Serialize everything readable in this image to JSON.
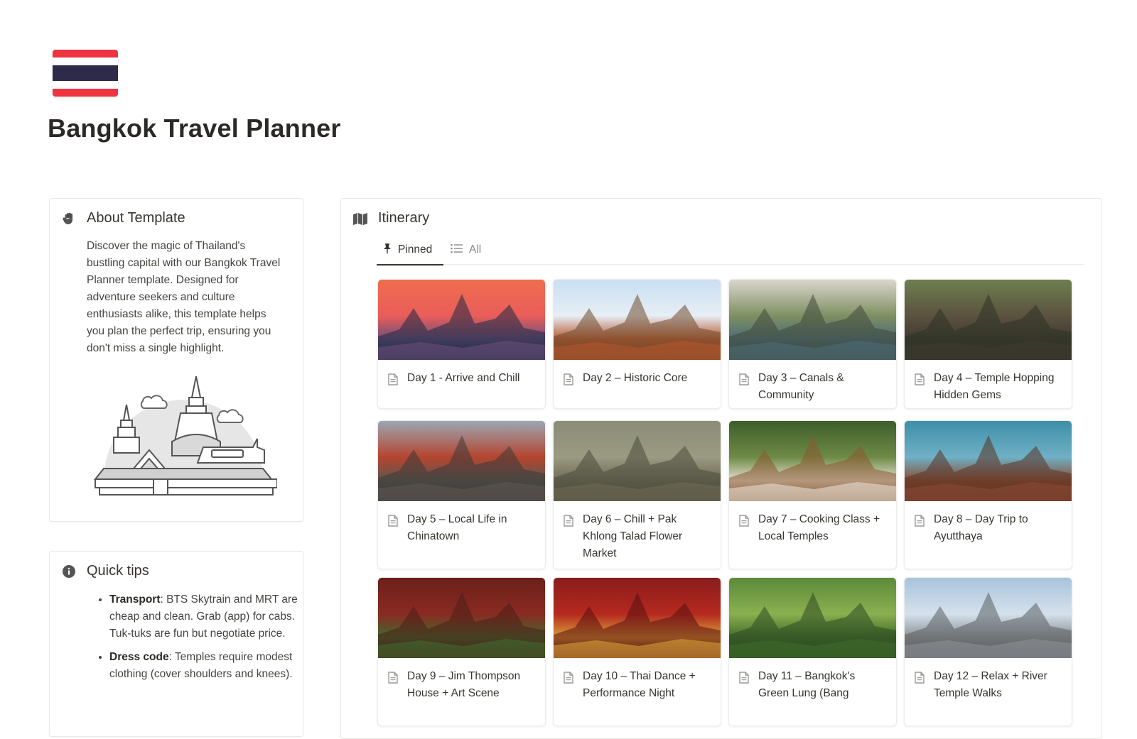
{
  "page": {
    "title": "Bangkok Travel Planner",
    "flag_icon": "thailand-flag-icon"
  },
  "about": {
    "icon": "hand-icon",
    "title": "About Template",
    "text": "Discover the magic of Thailand's bustling capital with our Bangkok Travel Planner template. Designed for adventure seekers and culture enthusiasts alike, this template helps you plan the perfect trip, ensuring you don't miss a single highlight.",
    "illustration_icon": "temple-illustration-icon"
  },
  "tips": {
    "icon": "info-icon",
    "title": "Quick tips",
    "items": [
      {
        "label": "Transport",
        "text": ": BTS Skytrain and MRT are cheap and clean. Grab (app) for cabs. Tuk-tuks are fun but negotiate price."
      },
      {
        "label": "Dress code",
        "text": ": Temples require modest clothing (cover shoulders and knees)."
      }
    ]
  },
  "itinerary": {
    "icon": "map-icon",
    "title": "Itinerary",
    "tabs": [
      {
        "label": "Pinned",
        "icon": "pin-icon",
        "active": true
      },
      {
        "label": "All",
        "icon": "list-icon",
        "active": false
      }
    ],
    "cards": [
      {
        "title": "Day 1 - Arrive and Chill",
        "image": "wat-arun-sunset",
        "colors": [
          "#f06d4f",
          "#e95d5a",
          "#6b4f7a",
          "#1f2a44"
        ]
      },
      {
        "title": "Day 2 – Historic Core",
        "image": "grand-palace",
        "colors": [
          "#c9dff2",
          "#e7eef5",
          "#b4552c",
          "#6f4a2e"
        ]
      },
      {
        "title": "Day 3 – Canals & Community",
        "image": "floating-canal",
        "colors": [
          "#d9d7cc",
          "#7f8f62",
          "#4b6a78",
          "#3f4a3a"
        ]
      },
      {
        "title": "Day 4 – Temple Hopping Hidden Gems",
        "image": "ruins-temple",
        "colors": [
          "#6d7f4e",
          "#5b5240",
          "#3f3a30",
          "#2e3326"
        ]
      },
      {
        "title": "Day 5 – Local Life in Chinatown",
        "image": "chinatown-street",
        "colors": [
          "#9aa7b4",
          "#b5452f",
          "#5d5650",
          "#3b3a38"
        ]
      },
      {
        "title": "Day 6 – Chill + Pak Khlong Talad Flower Market",
        "image": "sailing-ships-painting",
        "colors": [
          "#8a8d78",
          "#9b9a82",
          "#6e6a55",
          "#4a4a3c"
        ]
      },
      {
        "title": "Day 7 – Cooking Class + Local Temples",
        "image": "cooking-class",
        "colors": [
          "#3e5d2c",
          "#6f8a45",
          "#e6e0d6",
          "#8a5a32"
        ]
      },
      {
        "title": "Day 8 – Day Trip to Ayutthaya",
        "image": "ayutthaya-ruins",
        "colors": [
          "#3e8fa8",
          "#6fb0c6",
          "#8a4a33",
          "#5a3322"
        ]
      },
      {
        "title": "Day 9 – Jim Thompson House + Art Scene",
        "image": "jim-thompson-house",
        "colors": [
          "#6b1f1a",
          "#8a2b22",
          "#3f6a2e",
          "#4a1f18"
        ]
      },
      {
        "title": "Day 10 – Thai Dance + Performance Night",
        "image": "thai-dance",
        "colors": [
          "#8a1c1c",
          "#b5291f",
          "#d9a23a",
          "#5a1010"
        ]
      },
      {
        "title": "Day 11 – Bangkok's Green Lung (Bang",
        "image": "green-lung-bikes",
        "colors": [
          "#5d8a3a",
          "#8ab04f",
          "#3f6a2a",
          "#2e4a22"
        ]
      },
      {
        "title": "Day 12 – Relax + River Temple Walks",
        "image": "wat-arun-day",
        "colors": [
          "#a9c3dc",
          "#d4e1ec",
          "#8c8f93",
          "#5a5e63"
        ]
      }
    ]
  }
}
